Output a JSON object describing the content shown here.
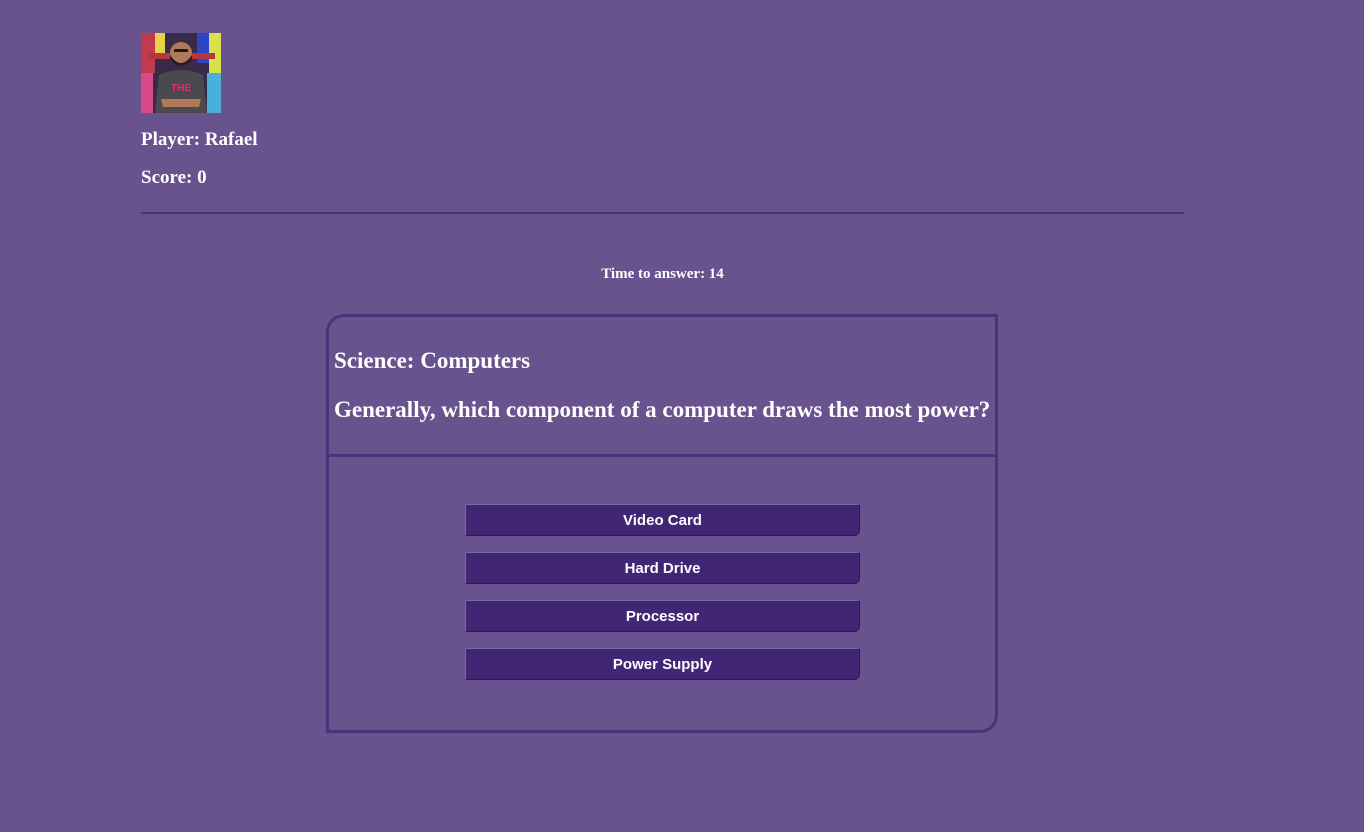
{
  "player": {
    "name_label": "Player: Rafael",
    "score_label": "Score: 0"
  },
  "timer": {
    "label": "Time to answer: 14"
  },
  "question": {
    "category": "Science: Computers",
    "text": "Generally, which component of a computer draws the most power?"
  },
  "answers": [
    {
      "label": "Video Card"
    },
    {
      "label": "Hard Drive"
    },
    {
      "label": "Processor"
    },
    {
      "label": "Power Supply"
    }
  ],
  "colors": {
    "background": "#68538f",
    "accent": "#4b327a",
    "button": "#422675",
    "text": "#ffffff"
  }
}
